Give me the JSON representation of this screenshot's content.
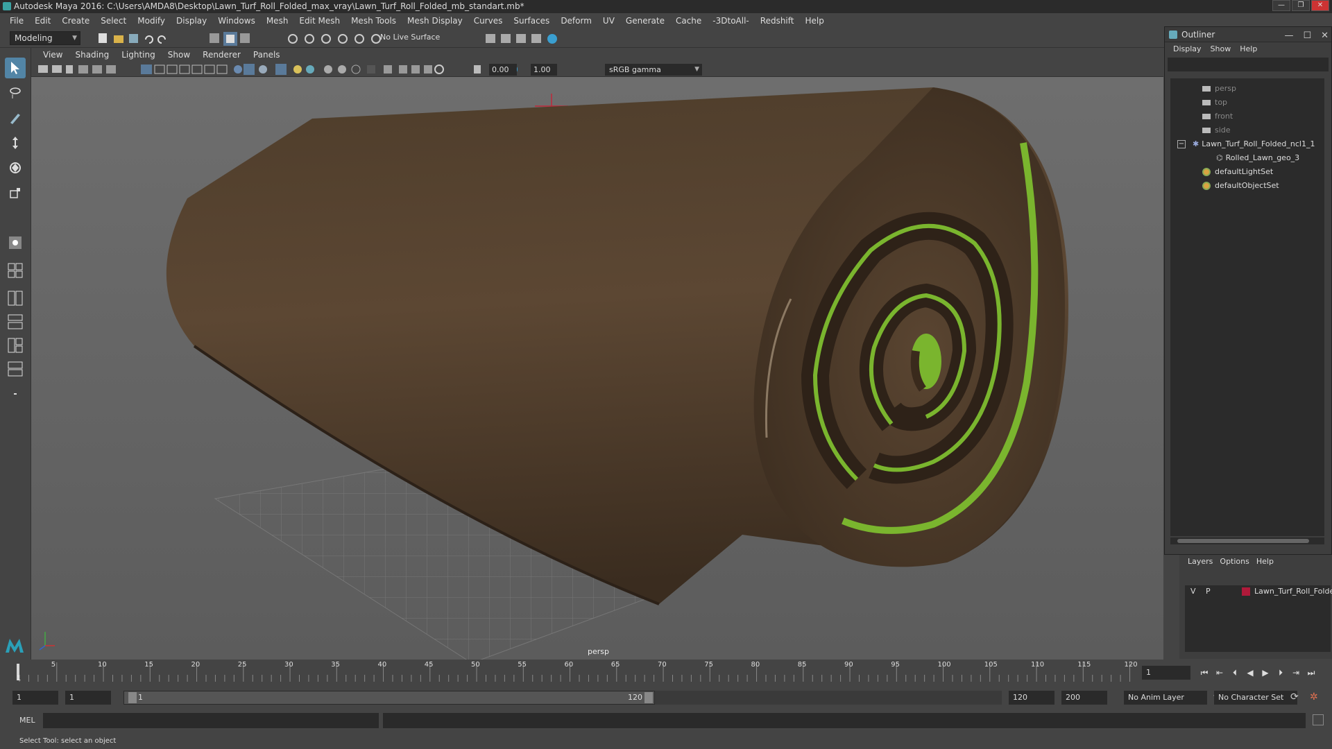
{
  "window": {
    "title": "Autodesk Maya 2016: C:\\Users\\AMDA8\\Desktop\\Lawn_Turf_Roll_Folded_max_vray\\Lawn_Turf_Roll_Folded_mb_standart.mb*",
    "buttons": [
      "—",
      "❐",
      "✕"
    ]
  },
  "menubar": {
    "items": [
      "File",
      "Edit",
      "Create",
      "Select",
      "Modify",
      "Display",
      "Windows",
      "Mesh",
      "Edit Mesh",
      "Mesh Tools",
      "Mesh Display",
      "Curves",
      "Surfaces",
      "Deform",
      "UV",
      "Generate",
      "Cache",
      "-3DtoAll-",
      "Redshift",
      "Help"
    ]
  },
  "statusline": {
    "mode": "Modeling",
    "live_surface": "No Live Surface"
  },
  "viewport_menu": {
    "items": [
      "View",
      "Shading",
      "Lighting",
      "Show",
      "Renderer",
      "Panels"
    ]
  },
  "viewport_toolbar": {
    "exposure": "0.00",
    "gamma_value": "1.00",
    "color_space": "sRGB gamma"
  },
  "viewport": {
    "camera_label": "persp"
  },
  "outliner": {
    "title": "Outliner",
    "title_buttons": [
      "—",
      "☐",
      "✕"
    ],
    "menu": [
      "Display",
      "Show",
      "Help"
    ],
    "items": [
      {
        "label": "persp",
        "type": "camera",
        "dim": true
      },
      {
        "label": "top",
        "type": "camera",
        "dim": true
      },
      {
        "label": "front",
        "type": "camera",
        "dim": true
      },
      {
        "label": "side",
        "type": "camera",
        "dim": true
      },
      {
        "label": "Lawn_Turf_Roll_Folded_ncl1_1",
        "type": "group"
      },
      {
        "label": "Rolled_Lawn_geo_3",
        "type": "mesh"
      },
      {
        "label": "defaultLightSet",
        "type": "set"
      },
      {
        "label": "defaultObjectSet",
        "type": "set"
      }
    ],
    "expand_toggle": "−"
  },
  "layers": {
    "menu": [
      "Layers",
      "Options",
      "Help"
    ],
    "row": {
      "v": "V",
      "p": "P",
      "name": "Lawn_Turf_Roll_Folded",
      "color": "#b01a3a"
    }
  },
  "timeline": {
    "ticks": [
      "5",
      "10",
      "15",
      "20",
      "25",
      "30",
      "35",
      "40",
      "45",
      "50",
      "55",
      "60",
      "65",
      "70",
      "75",
      "80",
      "85",
      "90",
      "95",
      "100",
      "105",
      "110",
      "115",
      "120"
    ],
    "start_tick": "1",
    "current_frame": "1"
  },
  "range": {
    "start": "1",
    "playback_start": "1",
    "slider_start": "1",
    "slider_end": "120",
    "playback_end": "120",
    "end": "200",
    "anim_layer": "No Anim Layer",
    "character_set": "No Character Set"
  },
  "cmdline": {
    "language": "MEL"
  },
  "helpline": {
    "text": "Select Tool: select an object"
  },
  "colors": {
    "accent": "#5285a6",
    "turf_brown": "#5a4632",
    "grass_green": "#7ab52e"
  }
}
